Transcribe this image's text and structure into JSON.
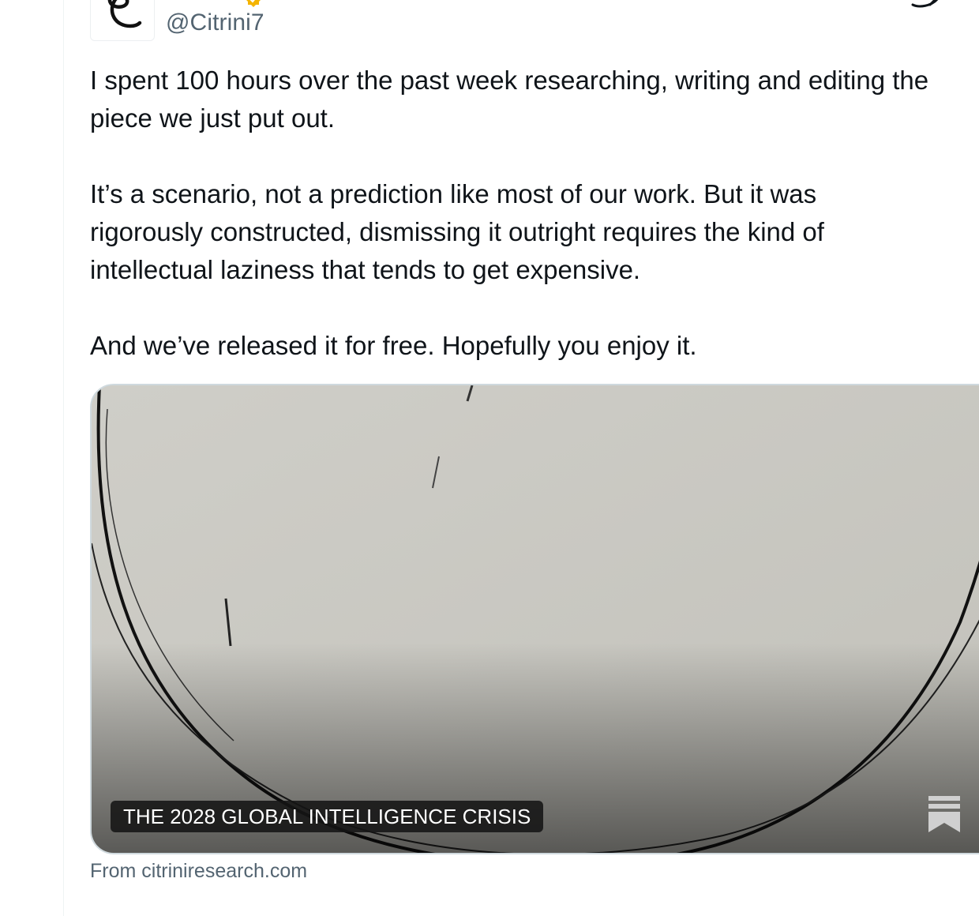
{
  "author": {
    "handle": "@Citrini7",
    "avatar_icon": "citrini-logo-icon",
    "badge_icon": "verified-badge-icon",
    "badge_color": "#f4b400"
  },
  "tweet": {
    "paragraphs": [
      {
        "lines": [
          "I spent 100 hours over the past week researching, writing and editing the",
          "piece we just put out."
        ]
      },
      {
        "lines": [
          "It’s a scenario, not a prediction like most of our work. But it was",
          "rigorously constructed, dismissing it outright requires the kind of",
          "intellectual laziness that tends to get expensive."
        ]
      },
      {
        "lines": [
          "And we’ve released it for free. Hopefully you enjoy it."
        ]
      }
    ]
  },
  "link_card": {
    "title": "THE 2028 GLOBAL INTELLIGENCE CRISIS",
    "source": "From citriniresearch.com",
    "image_icon": "ink-circle-sketch-image",
    "corner_icon": "substack-bookmark-icon"
  },
  "colors": {
    "text_primary": "#0f1419",
    "text_secondary": "#536471",
    "card_border": "#cfd9de",
    "image_background": "#c7c6bf"
  }
}
